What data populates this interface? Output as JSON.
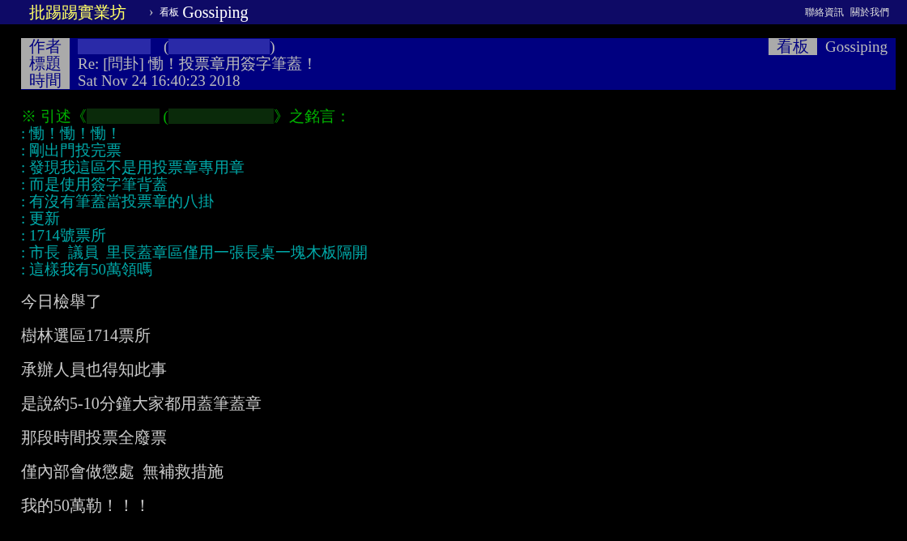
{
  "topbar": {
    "site": "批踢踢實業坊",
    "separator": "›",
    "board_label": "看板",
    "board": "Gossiping",
    "links": [
      "聯絡資訊",
      "關於我們"
    ]
  },
  "header": {
    "rows": [
      {
        "kind": "author",
        "label": "作者",
        "open": "(",
        "close": ")"
      },
      {
        "kind": "text",
        "label": "標題",
        "value": "Re: [問卦] 慟！投票章用簽字筆蓋！"
      },
      {
        "kind": "text",
        "label": "時間",
        "value": "Sat Nov 24 16:40:23 2018"
      }
    ],
    "board_label": "看板",
    "board": "Gossiping"
  },
  "quote_header": {
    "start": "※ 引述《",
    "open": " (",
    "end": "》之銘言："
  },
  "quote_lines": [
    ": 慟！慟！慟！",
    ": 剛出門投完票",
    ": 發現我這區不是用投票章專用章",
    ": 而是使用簽字筆背蓋",
    ": 有沒有筆蓋當投票章的八掛",
    ": 更新",
    ": 1714號票所",
    ": 市長  議員  里長蓋章區僅用一張長桌一塊木板隔開",
    ": 這樣我有50萬領嗎"
  ],
  "body_lines": [
    "今日檢舉了",
    "樹林選區1714票所",
    "承辦人員也得知此事",
    "是說約5-10分鐘大家都用蓋筆蓋章",
    "那段時間投票全廢票",
    "僅內部會做懲處  無補救措施",
    "我的50萬勒！！！"
  ]
}
